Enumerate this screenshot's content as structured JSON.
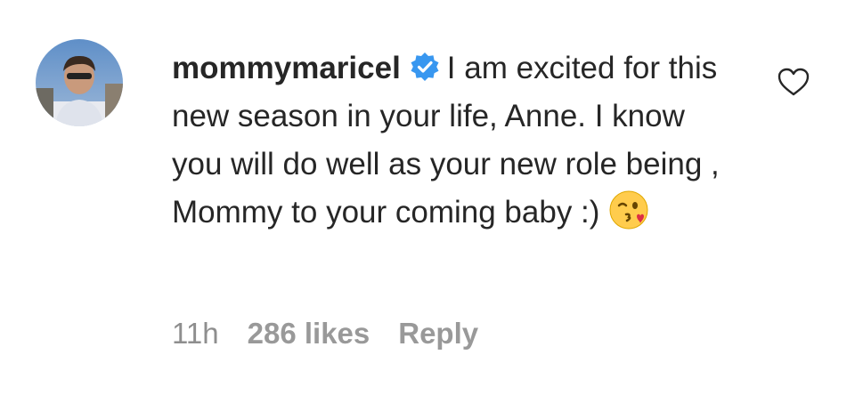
{
  "comment": {
    "username": "mommymaricel",
    "text": "I am excited for this new season in your life, Anne. I know you will do well as your new role being , Mommy to your coming baby :)",
    "emoji": "kissing-winking-face",
    "verified_icon": "verified-badge-icon",
    "avatar_icon": "avatar",
    "like_icon": "heart-outline-icon",
    "colors": {
      "text": "#262626",
      "meta": "#8e8e8e",
      "verified": "#3897f0"
    }
  },
  "meta": {
    "time": "11h",
    "likes": "286 likes",
    "reply": "Reply"
  }
}
